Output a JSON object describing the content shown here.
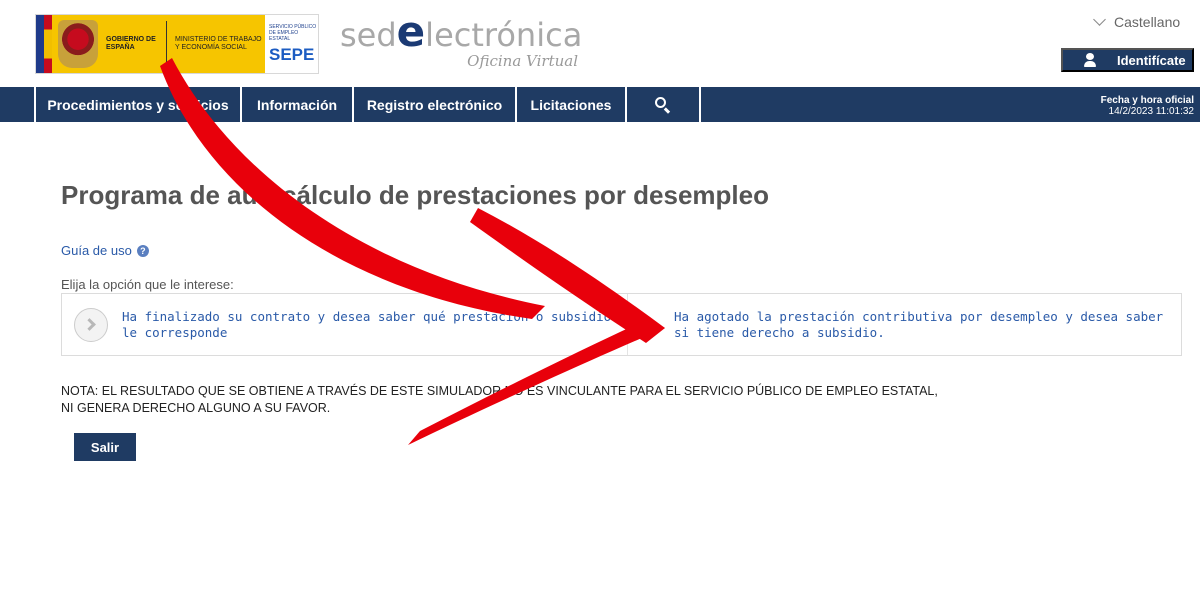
{
  "header": {
    "gov_logo": {
      "gobierno_text": "GOBIERNO DE ESPAÑA",
      "ministerio_text": "MINISTERIO DE TRABAJO Y ECONOMÍA SOCIAL",
      "sepe_small_text": "SERVICIO PÚBLICO DE EMPLEO ESTATAL",
      "sepe_text": "SEPE"
    },
    "sede_logo": {
      "prefix": "sed",
      "e": "e",
      "suffix": "lectrónica",
      "subtitle": "Oficina Virtual"
    },
    "language": {
      "icon": "chevron-down-icon",
      "value": "Castellano"
    },
    "login_button": {
      "icon": "user-icon",
      "label": "Identifícate"
    }
  },
  "nav": {
    "items": [
      {
        "label": "Procedimientos y servicios"
      },
      {
        "label": "Información"
      },
      {
        "label": "Registro electrónico"
      },
      {
        "label": "Licitaciones"
      }
    ],
    "search_icon": "search-icon",
    "datetime_label": "Fecha y hora oficial",
    "datetime_value": "14/2/2023 11:01:32"
  },
  "main": {
    "title": "Programa de autocálculo de prestaciones por desempleo",
    "guide_link": "Guía de uso",
    "guide_icon": "help-icon",
    "choose_label": "Elija la opción que le interese:",
    "options": [
      {
        "icon": "chevron-right-icon",
        "text": "Ha finalizado su contrato y desea saber qué prestación o subsidio le corresponde"
      },
      {
        "text": "Ha agotado la prestación contributiva por desempleo y desea saber si tiene derecho a subsidio."
      }
    ],
    "note": "NOTA: EL RESULTADO QUE SE OBTIENE A TRAVÉS DE ESTE SIMULADOR NO ES VINCULANTE PARA EL SERVICIO PÚBLICO DE EMPLEO ESTATAL, NI GENERA DERECHO ALGUNO A SU FAVOR.",
    "exit_button": "Salir"
  },
  "colors": {
    "navy": "#1f3b63",
    "link_blue": "#2a5aa8",
    "title_gray": "#555555",
    "arrow_red": "#e8000b"
  }
}
